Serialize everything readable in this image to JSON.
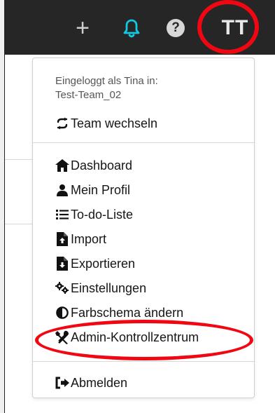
{
  "topbar": {
    "plus_icon": "plus-icon",
    "bell_icon": "bell-icon",
    "help_icon": "question-circle-icon",
    "avatar_initials": "TT",
    "accent_color": "#12c9df",
    "background_color": "#262626",
    "highlight_color": "#f10712"
  },
  "dropdown": {
    "logged_in_line": "Eingeloggt als Tina in:",
    "team_name": "Test-Team_02",
    "switch_team": {
      "label": "Team wechseln",
      "icon": "swap-arrows-icon"
    },
    "items": [
      {
        "label": "Dashboard",
        "icon": "home-icon"
      },
      {
        "label": "Mein Profil",
        "icon": "user-icon"
      },
      {
        "label": "To-do-Liste",
        "icon": "list-icon"
      },
      {
        "label": "Import",
        "icon": "file-upload-icon"
      },
      {
        "label": "Exportieren",
        "icon": "file-download-icon"
      },
      {
        "label": "Einstellungen",
        "icon": "gears-icon"
      },
      {
        "label": "Farbschema ändern",
        "icon": "contrast-icon"
      },
      {
        "label": "Admin-Kontrollzentrum",
        "icon": "tools-icon"
      }
    ],
    "logout": {
      "label": "Abmelden",
      "icon": "sign-out-icon"
    }
  }
}
